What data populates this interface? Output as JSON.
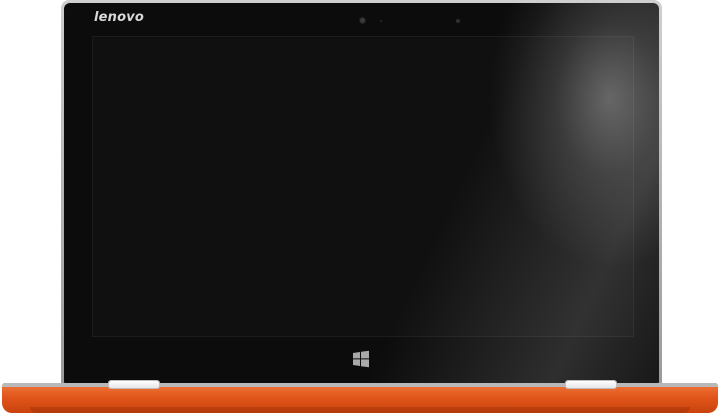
{
  "brand": {
    "logo_text": "lenovo"
  },
  "device": {
    "lid_color": "#0c0c0c",
    "base_color": "#e2571b",
    "rim_color": "#b0b0b0"
  },
  "icons": {
    "windows": "windows-logo-icon",
    "camera": "camera-icon",
    "microphone": "microphone-icon"
  }
}
